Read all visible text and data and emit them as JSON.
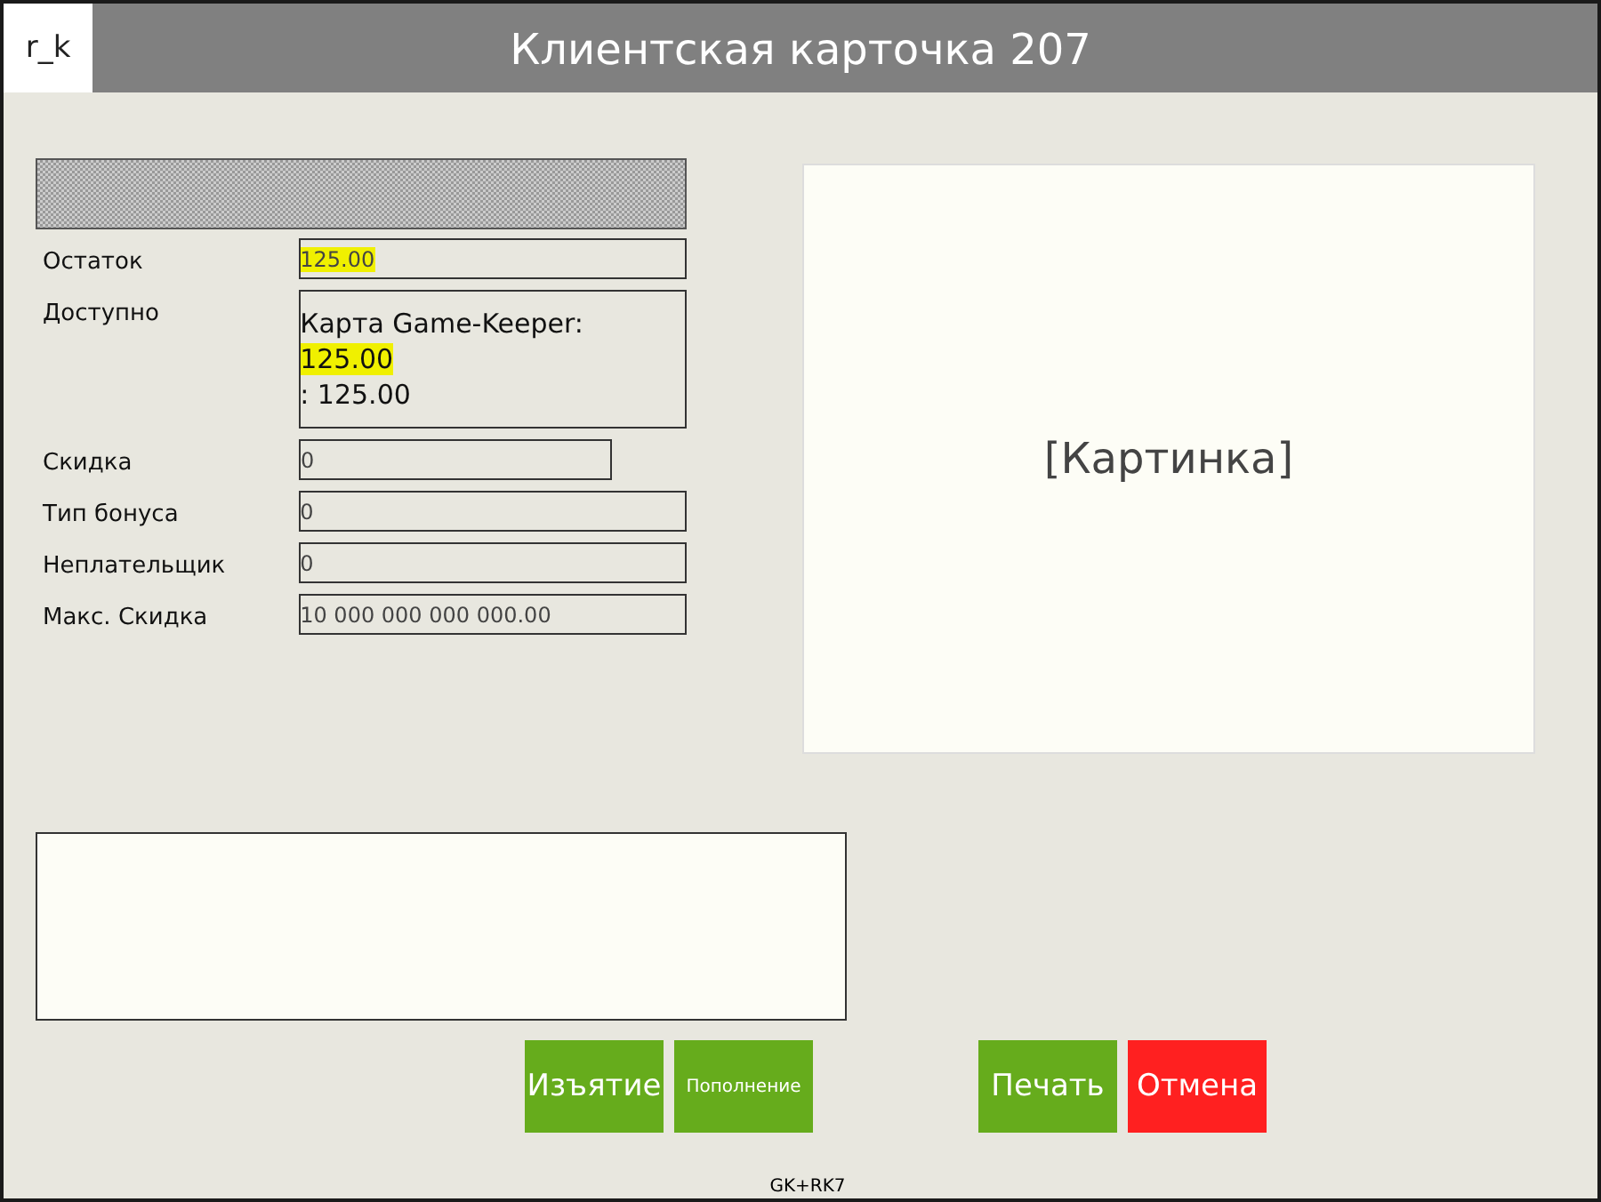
{
  "window": {
    "logo": "r_k",
    "title": "Клиентская карточка 207"
  },
  "fields": [
    {
      "label": "Остаток",
      "kind": "single",
      "highlighted": true,
      "value": "125.00"
    },
    {
      "label": "Доступно",
      "kind": "multi",
      "lines": [
        {
          "text": "Карта Game-Keeper:",
          "highlighted": false
        },
        {
          "text": "125.00",
          "highlighted": true
        },
        {
          "text": ": 125.00",
          "highlighted": false
        }
      ]
    },
    {
      "label": "Скидка",
      "kind": "short",
      "highlighted": false,
      "value": "0"
    },
    {
      "label": "Тип бонуса",
      "kind": "single",
      "highlighted": false,
      "value": "0"
    },
    {
      "label": "Неплательщик",
      "kind": "single",
      "highlighted": false,
      "value": "0"
    },
    {
      "label": "Макс. Скидка",
      "kind": "single",
      "highlighted": false,
      "value": "10 000 000 000 000.00"
    }
  ],
  "image_panel": {
    "text": "[Картинка]"
  },
  "button_groups": [
    [
      {
        "label": "Изъятие",
        "kind": "large",
        "color": "#66ac1c"
      },
      {
        "label": "Пополнение",
        "kind": "small",
        "color": "#66ac1c"
      }
    ],
    [
      {
        "label": "Печать",
        "kind": "large",
        "color": "#66ac1c"
      },
      {
        "label": "Отмена",
        "kind": "large",
        "color": "#ff2020"
      }
    ]
  ],
  "footer": "GK+RK7"
}
